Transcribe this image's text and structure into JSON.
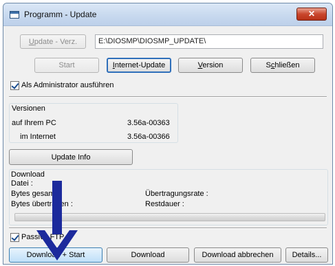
{
  "window": {
    "title": "Programm - Update",
    "close_glyph": "✕"
  },
  "update_dir": {
    "button_label": "Update - Verz.",
    "path_value": "E:\\DIOSMP\\DIOSMP_UPDATE\\"
  },
  "toolbar": {
    "start_label": "Start",
    "internet_update_label": "Internet-Update",
    "version_label": "Version",
    "close_label": "Schließen"
  },
  "run_as_admin": {
    "label": "Als Administrator ausführen",
    "checked": true
  },
  "versions": {
    "title": "Versionen",
    "local_label": "auf Ihrem PC",
    "local_value": "3.56a-00363",
    "internet_label": "im Internet",
    "internet_value": "3.56a-00366"
  },
  "update_info_label": "Update Info",
  "download": {
    "title": "Download",
    "file_label": "Datei :",
    "bytes_total_label": "Bytes gesamt :",
    "bytes_transferred_label": "Bytes übertragen :",
    "rate_label": "Übertragungsrate :",
    "remaining_label": "Restdauer :",
    "progress": 0
  },
  "passive_ftp": {
    "label": "Passive FTP",
    "checked": true
  },
  "bottom_buttons": {
    "download_start": "Download + Start",
    "download": "Download",
    "download_cancel": "Download abbrechen",
    "details": "Details..."
  },
  "annotation": {
    "arrow_color": "#1c2a9c"
  }
}
